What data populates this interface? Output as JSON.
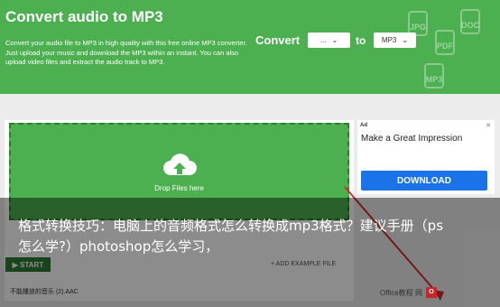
{
  "hero": {
    "title": "Convert audio to MP3",
    "description": "Convert your audio file to MP3 in high quality with this free online MP3 converter. Just upload your music and download the MP3 within an instant. You can also upload video files and extract the audio track to MP3.",
    "convert_label": "Convert",
    "from_value": "...",
    "to_label": "to",
    "to_value": "MP3",
    "deco_icons": [
      "JPG",
      "PDF",
      "DOC",
      "MP3"
    ]
  },
  "upload": {
    "drop_text": "Drop Files here",
    "start_label": "▶ START",
    "add_example_label": "+ ADD EXAMPLE FILE",
    "file_row": "不能播放的音乐 (2).AAC"
  },
  "ad": {
    "badge": "Ad",
    "close": "✕",
    "title": "Make a Great Impression",
    "button": "DOWNLOAD"
  },
  "overlay": {
    "text": "格式转换技巧：电脑上的音频格式怎么转换成mp3格式？建议手册（ps怎么学?）photoshop怎么学习，"
  },
  "watermark": {
    "text": "Office教程 网"
  },
  "colors": {
    "green": "#4caf50",
    "dark_green": "#2e7d32",
    "ad_blue": "#1a73e8"
  }
}
